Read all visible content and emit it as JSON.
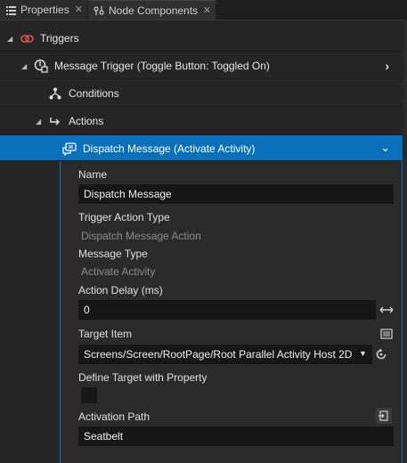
{
  "tabs": [
    {
      "label": "Properties",
      "icon": "properties-icon",
      "closable": true
    },
    {
      "label": "Node Components",
      "icon": "node-components-icon",
      "closable": true
    }
  ],
  "tree": {
    "triggers": {
      "label": "Triggers",
      "icon": "trigger-icon"
    },
    "message_trigger": {
      "label": "Message Trigger (Toggle Button: Toggled On)",
      "icon": "message-trigger-icon"
    },
    "conditions": {
      "label": "Conditions",
      "icon": "conditions-icon"
    },
    "actions": {
      "label": "Actions",
      "icon": "actions-icon"
    },
    "dispatch": {
      "label": "Dispatch Message (Activate Activity)",
      "icon": "dispatch-message-icon"
    }
  },
  "properties": {
    "name_label": "Name",
    "name_value": "Dispatch Message",
    "trigger_action_type_label": "Trigger Action Type",
    "trigger_action_type_value": "Dispatch Message Action",
    "message_type_label": "Message Type",
    "message_type_value": "Activate Activity",
    "action_delay_label": "Action Delay (ms)",
    "action_delay_value": "0",
    "target_item_label": "Target Item",
    "target_item_value": "Screens/Screen/RootPage/Root Parallel Activity Host 2D",
    "define_target_label": "Define Target with Property",
    "define_target_checked": false,
    "activation_path_label": "Activation Path",
    "activation_path_value": "Seatbelt"
  },
  "colors": {
    "selection": "#0a70b9",
    "background": "#252526",
    "field": "#161616",
    "trigger_icon": "#e05252"
  }
}
